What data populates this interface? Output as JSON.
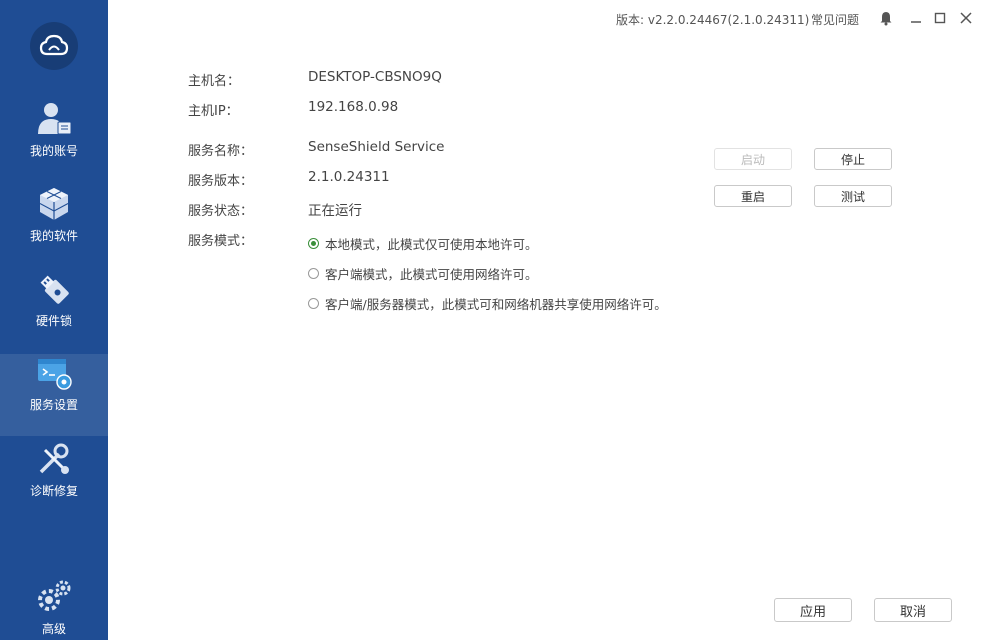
{
  "titlebar": {
    "version": "版本: v2.2.0.24467(2.1.0.24311)",
    "faq": "常见问题",
    "icons": [
      "bell-icon",
      "minimize-icon",
      "maximize-icon",
      "close-icon"
    ]
  },
  "sidebar": {
    "logo_icon": "cloud-logo-icon",
    "items": [
      {
        "label": "我的账号",
        "icon": "account-icon"
      },
      {
        "label": "我的软件",
        "icon": "cubes-icon"
      },
      {
        "label": "硬件锁",
        "icon": "usb-lock-icon"
      },
      {
        "label": "服务设置",
        "icon": "service-settings-icon",
        "active": true
      },
      {
        "label": "诊断修复",
        "icon": "repair-tools-icon"
      },
      {
        "label": "高级",
        "icon": "gears-icon"
      }
    ],
    "bg_color": "#1f4d94"
  },
  "info": {
    "hostname_label": "主机名：",
    "hostname_value": "DESKTOP-CBSNO9Q",
    "hostip_label": "主机IP：",
    "hostip_value": "192.168.0.98",
    "service_name_label": "服务名称：",
    "service_name_value": "SenseShield Service",
    "service_version_label": "服务版本：",
    "service_version_value": "2.1.0.24311",
    "service_status_label": "服务状态：",
    "service_status_value": "正在运行",
    "service_mode_label": "服务模式："
  },
  "modes": [
    {
      "label": "本地模式，此模式仅可使用本地许可。",
      "checked": true
    },
    {
      "label": "客户端模式，此模式可使用网络许可。",
      "checked": false
    },
    {
      "label": "客户端/服务器模式，此模式可和网络机器共享使用网络许可。",
      "checked": false
    }
  ],
  "service_buttons": {
    "start": "启动",
    "stop": "停止",
    "restart": "重启",
    "test": "测试"
  },
  "footer": {
    "apply": "应用",
    "cancel": "取消"
  }
}
